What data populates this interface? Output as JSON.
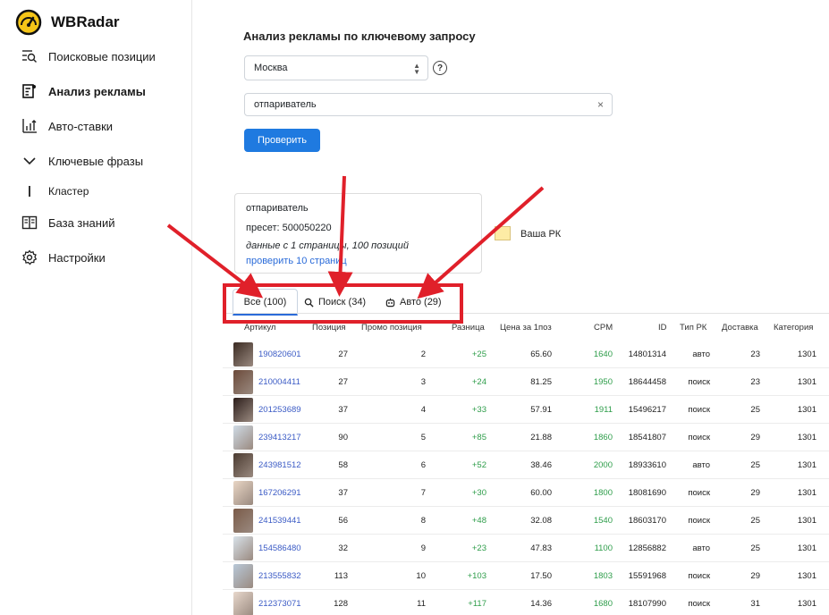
{
  "app": {
    "name": "WBRadar"
  },
  "sidebar": {
    "items": [
      {
        "label": "Поисковые позиции",
        "icon": "search-list-icon"
      },
      {
        "label": "Анализ рекламы",
        "icon": "ad-analysis-icon",
        "active": true
      },
      {
        "label": "Авто-ставки",
        "icon": "chart-arrow-icon"
      },
      {
        "label": "Ключевые фразы",
        "icon": "chevron-down-icon"
      },
      {
        "label": "Кластер",
        "icon": "sub-bar"
      },
      {
        "label": "База знаний",
        "icon": "book-icon"
      },
      {
        "label": "Настройки",
        "icon": "gear-icon"
      }
    ]
  },
  "main": {
    "title": "Анализ рекламы по ключевому запросу",
    "city_select": {
      "value": "Москва"
    },
    "help_label": "?",
    "query_input": {
      "value": "отпариватель"
    },
    "check_button": "Проверить",
    "info": {
      "query": "отпариватель",
      "preset": "пресет: 500050220",
      "data_note": "данные с 1 страницы, 100 позиций",
      "link": "проверить 10 страниц"
    },
    "legend": {
      "label": "Ваша РК",
      "color": "#fdeca5"
    }
  },
  "tabs": [
    {
      "label": "Все (100)",
      "active": true
    },
    {
      "label": "Поиск (34)",
      "icon": "magnifier-icon"
    },
    {
      "label": "Авто (29)",
      "icon": "robot-icon"
    }
  ],
  "table": {
    "columns": [
      "Артикул",
      "Позиция",
      "Промо позиция",
      "Разница",
      "Цена за 1поз",
      "CPM",
      "ID",
      "Тип РК",
      "Доставка",
      "Категория"
    ],
    "rows": [
      [
        "190820601",
        "27",
        "2",
        "+25",
        "65.60",
        "1640",
        "14801314",
        "авто",
        "23",
        "1301"
      ],
      [
        "210004411",
        "27",
        "3",
        "+24",
        "81.25",
        "1950",
        "18644458",
        "поиск",
        "23",
        "1301"
      ],
      [
        "201253689",
        "37",
        "4",
        "+33",
        "57.91",
        "1911",
        "15496217",
        "поиск",
        "25",
        "1301"
      ],
      [
        "239413217",
        "90",
        "5",
        "+85",
        "21.88",
        "1860",
        "18541807",
        "поиск",
        "29",
        "1301"
      ],
      [
        "243981512",
        "58",
        "6",
        "+52",
        "38.46",
        "2000",
        "18933610",
        "авто",
        "25",
        "1301"
      ],
      [
        "167206291",
        "37",
        "7",
        "+30",
        "60.00",
        "1800",
        "18081690",
        "поиск",
        "29",
        "1301"
      ],
      [
        "241539441",
        "56",
        "8",
        "+48",
        "32.08",
        "1540",
        "18603170",
        "поиск",
        "25",
        "1301"
      ],
      [
        "154586480",
        "32",
        "9",
        "+23",
        "47.83",
        "1100",
        "12856882",
        "авто",
        "25",
        "1301"
      ],
      [
        "213555832",
        "113",
        "10",
        "+103",
        "17.50",
        "1803",
        "15591968",
        "поиск",
        "29",
        "1301"
      ],
      [
        "212373071",
        "128",
        "11",
        "+117",
        "14.36",
        "1680",
        "18107990",
        "поиск",
        "31",
        "1301"
      ]
    ]
  },
  "colors": {
    "accent": "#1f7ae0",
    "link": "#3b5bc5",
    "positive": "#2e9d4a",
    "annotation": "#e0202a"
  }
}
